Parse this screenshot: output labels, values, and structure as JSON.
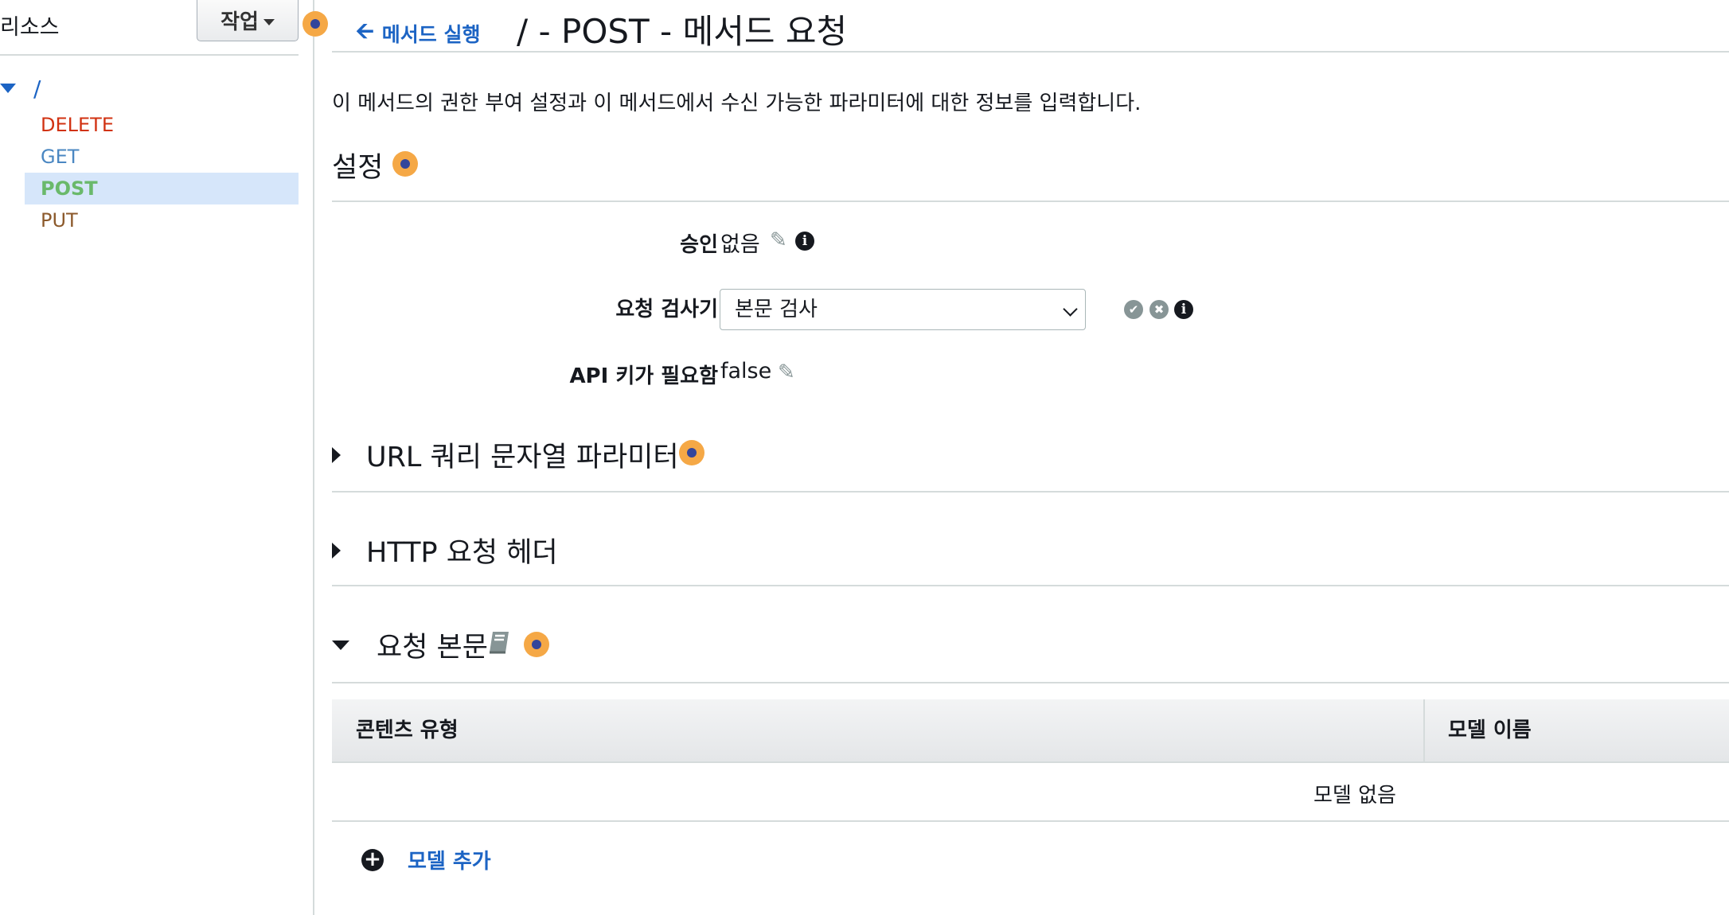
{
  "sidebar": {
    "title": "리소스",
    "actions_label": "작업",
    "root": "/",
    "methods": [
      {
        "label": "DELETE",
        "color": "#d13212",
        "active": false
      },
      {
        "label": "GET",
        "color": "#4a87c2",
        "active": false
      },
      {
        "label": "POST",
        "color": "#6ab96b",
        "active": true
      },
      {
        "label": "PUT",
        "color": "#8c5a2c",
        "active": false
      }
    ]
  },
  "header": {
    "back_link": "메서드 실행",
    "title": "/ - POST - 메서드 요청"
  },
  "description": "이 메서드의 권한 부여 설정과 이 메서드에서 수신 가능한 파라미터에 대한 정보를 입력합니다.",
  "settings": {
    "title": "설정",
    "authorization": {
      "label": "승인",
      "value": "없음"
    },
    "request_validator": {
      "label": "요청 검사기",
      "value": "본문 검사"
    },
    "api_key": {
      "label": "API 키가 필요함",
      "value": "false"
    }
  },
  "sections": {
    "query_params": "URL 쿼리 문자열 파라미터",
    "http_headers": "HTTP 요청 헤더",
    "request_body": "요청 본문"
  },
  "models_table": {
    "columns": [
      "콘텐츠 유형",
      "모델 이름"
    ],
    "empty_text": "모델 없음",
    "add_label": "모델 추가"
  },
  "colors": {
    "link": "#1c64c4",
    "hint_dot": "#f5a846",
    "active_row": "#d6e6fa"
  }
}
